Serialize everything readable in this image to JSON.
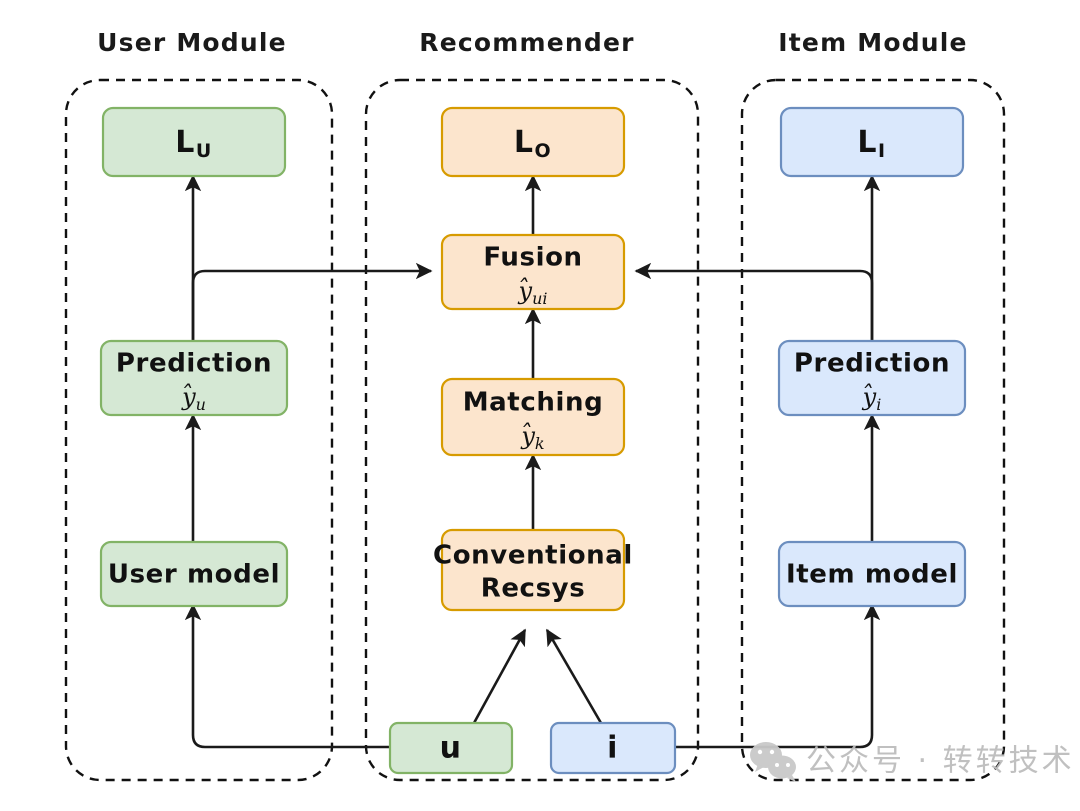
{
  "diagram": {
    "title_row": [
      {
        "id": "user-module",
        "label": "User Module"
      },
      {
        "id": "recommender",
        "label": "Recommender"
      },
      {
        "id": "item-module",
        "label": "Item Module"
      }
    ],
    "colors": {
      "green_fill": "#d5e8d4",
      "green_stroke": "#82b366",
      "orange_fill": "#fce5cd",
      "orange_stroke": "#d79b00",
      "blue_fill": "#dae8fc",
      "blue_stroke": "#6c8ebf",
      "line": "#1a1a1a",
      "watermark": "#bdbdbd"
    },
    "nodes": {
      "loss_user": {
        "label": "L",
        "sub": "U"
      },
      "loss_overall": {
        "label": "L",
        "sub": "O"
      },
      "loss_item": {
        "label": "L",
        "sub": "I"
      },
      "fusion": {
        "label": "Fusion",
        "formula": "y",
        "formula_sub": "ui"
      },
      "matching": {
        "label": "Matching",
        "formula": "y",
        "formula_sub": "k"
      },
      "conventional_recsys": {
        "line1": "Conventional",
        "line2": "Recsys"
      },
      "prediction_user": {
        "label": "Prediction",
        "formula": "y",
        "formula_sub": "u"
      },
      "prediction_item": {
        "label": "Prediction",
        "formula": "y",
        "formula_sub": "i"
      },
      "user_model": {
        "label": "User model"
      },
      "item_model": {
        "label": "Item model"
      },
      "input_user": {
        "label": "u"
      },
      "input_item": {
        "label": "i"
      }
    },
    "watermark": {
      "icon": "wechat-icon",
      "text": "公众号 · 转转技术"
    }
  }
}
